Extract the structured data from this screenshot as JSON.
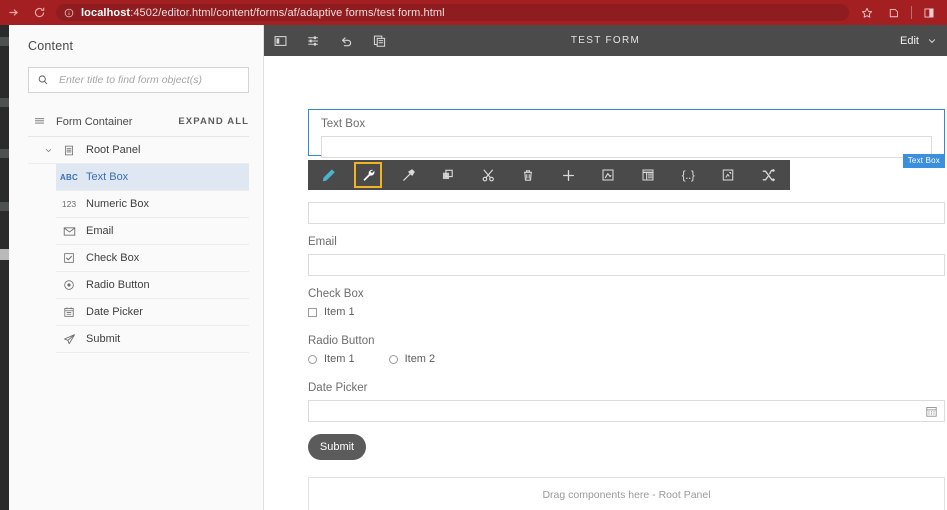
{
  "browser": {
    "forward_icon": "forward-arrow-icon",
    "reload_icon": "reload-icon",
    "info_icon": "info-circle-icon",
    "url_host": "localhost",
    "url_path": ":4502/editor.html/content/forms/af/adaptive forms/test form.html",
    "bookmark_icon": "star-icon",
    "extensions_icon": "extensions-icon",
    "profile_icon": "profile-window-icon",
    "bar_color": "#a41f22"
  },
  "sidebar": {
    "title": "Content",
    "search": {
      "placeholder": "Enter title to find form object(s)",
      "value": "",
      "icon": "search-icon"
    },
    "form_container": {
      "label": "Form Container",
      "icon": "form-container-icon",
      "expand_all": "EXPAND ALL"
    },
    "root": {
      "label": "Root Panel",
      "icon": "panel-icon",
      "caret": "chevron-down-icon"
    },
    "items": [
      {
        "label": "Text Box",
        "icon": "abc-icon",
        "glyph": "ABC",
        "selected": true
      },
      {
        "label": "Numeric Box",
        "icon": "numeric-icon",
        "glyph": "123",
        "selected": false
      },
      {
        "label": "Email",
        "icon": "envelope-icon",
        "glyph": "",
        "selected": false
      },
      {
        "label": "Check Box",
        "icon": "checkbox-icon",
        "glyph": "",
        "selected": false
      },
      {
        "label": "Radio Button",
        "icon": "radio-icon",
        "glyph": "",
        "selected": false
      },
      {
        "label": "Date Picker",
        "icon": "calendar-icon",
        "glyph": "",
        "selected": false
      },
      {
        "label": "Submit",
        "icon": "paper-plane-icon",
        "glyph": "",
        "selected": false
      }
    ]
  },
  "editor": {
    "toolbar_icons": [
      "sidebar-toggle-icon",
      "page-properties-icon",
      "undo-icon",
      "page-copy-icon"
    ],
    "title": "TEST FORM",
    "mode_label": "Edit",
    "mode_caret": "chevron-down-icon"
  },
  "component_toolbar": {
    "highlight_color": "#f0b323",
    "accent_color": "#4ab3cf",
    "items": [
      {
        "name": "edit-pencil-icon",
        "state": "accent"
      },
      {
        "name": "configure-wrench-icon",
        "state": "active"
      },
      {
        "name": "rule-editor-icon",
        "state": "normal"
      },
      {
        "name": "copy-icon",
        "state": "normal"
      },
      {
        "name": "cut-icon",
        "state": "normal"
      },
      {
        "name": "delete-trash-icon",
        "state": "normal"
      },
      {
        "name": "insert-plus-icon",
        "state": "normal"
      },
      {
        "name": "group-icon",
        "state": "normal"
      },
      {
        "name": "layout-icon",
        "state": "normal"
      },
      {
        "name": "expression-icon",
        "state": "normal",
        "glyph": "{..}"
      },
      {
        "name": "fragment-icon",
        "state": "normal"
      },
      {
        "name": "swap-icon",
        "state": "normal"
      }
    ]
  },
  "form": {
    "selected": {
      "label": "Text Box",
      "value": "",
      "badge": "Text Box",
      "badge_color": "#3b8fdd",
      "border_color": "#2e8bdc"
    },
    "fields": [
      {
        "label": "",
        "type": "text",
        "value": ""
      },
      {
        "label": "Email",
        "type": "text",
        "value": ""
      },
      {
        "label": "Check Box",
        "type": "checkbox",
        "options": [
          "Item 1"
        ]
      },
      {
        "label": "Radio Button",
        "type": "radio",
        "options": [
          "Item 1",
          "Item 2"
        ]
      },
      {
        "label": "Date Picker",
        "type": "date",
        "value": "",
        "icon": "calendar-icon"
      }
    ],
    "submit_label": "Submit",
    "dropzone_text": "Drag components here - Root Panel"
  }
}
